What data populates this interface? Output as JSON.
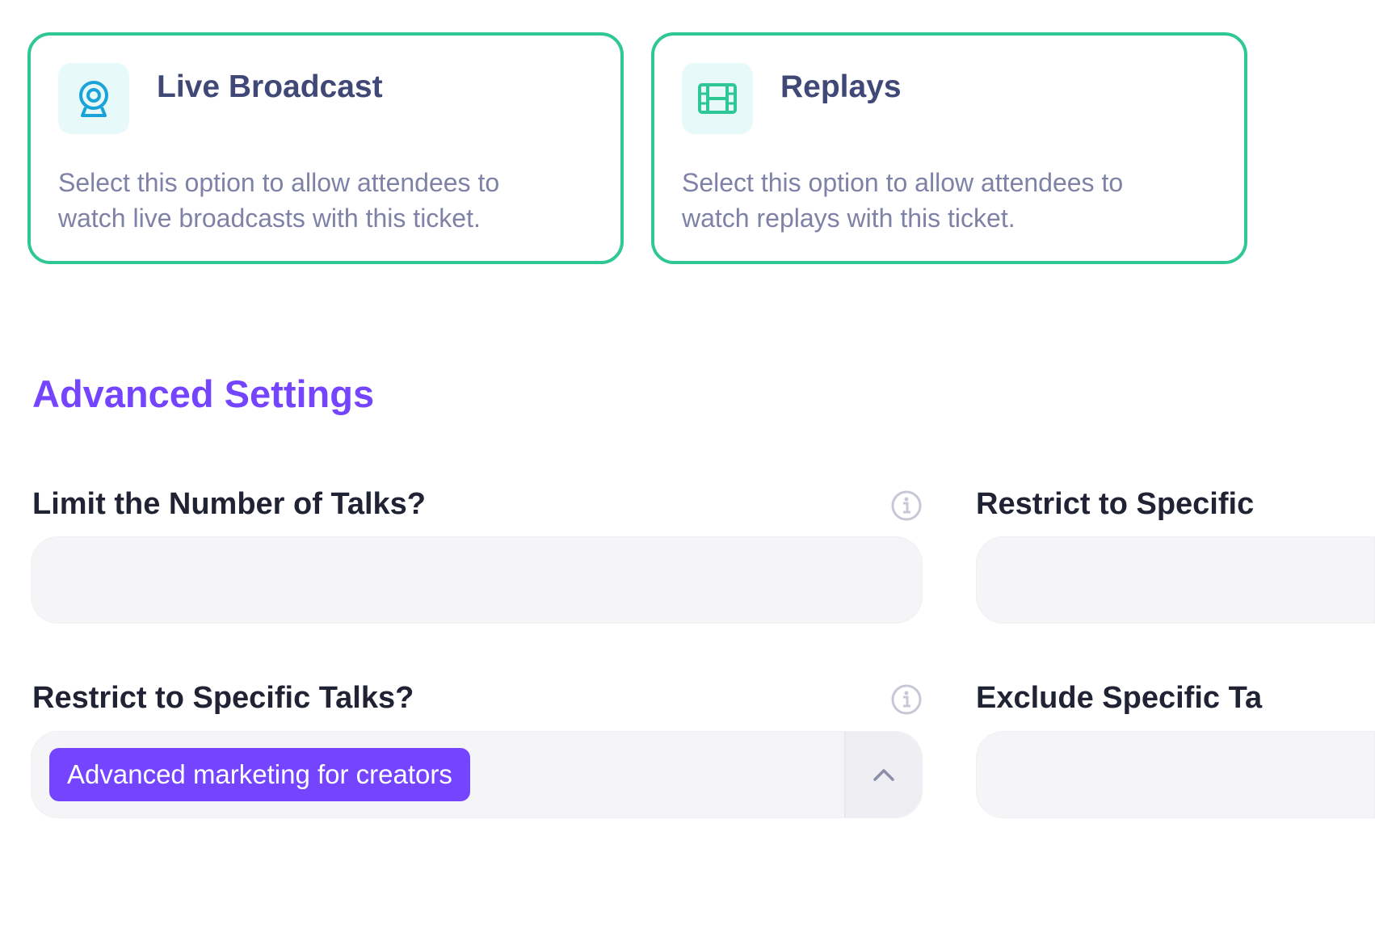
{
  "options": [
    {
      "title": "Live Broadcast",
      "description_line1": "Select this option to allow attendees to",
      "description_line2": "watch live broadcasts with this ticket.",
      "icon": "webcam-icon",
      "selected": true
    },
    {
      "title": "Replays",
      "description_line1": "Select this option to allow attendees to",
      "description_line2": "watch replays with this ticket.",
      "icon": "film-icon",
      "selected": true
    }
  ],
  "advanced": {
    "title": "Advanced Settings",
    "fields": {
      "limit_talks": {
        "label": "Limit the Number of Talks?",
        "value": ""
      },
      "restrict_talks": {
        "label": "Restrict to Specific Talks?",
        "selected_chips": [
          "Advanced marketing for creators"
        ]
      },
      "restrict_right": {
        "label": "Restrict to Specific"
      },
      "exclude_right": {
        "label": "Exclude Specific Ta"
      }
    }
  },
  "colors": {
    "accent": "#7444ff",
    "card_border": "#2fc795",
    "title_text": "#3f4876",
    "muted_text": "#7d82a6"
  }
}
